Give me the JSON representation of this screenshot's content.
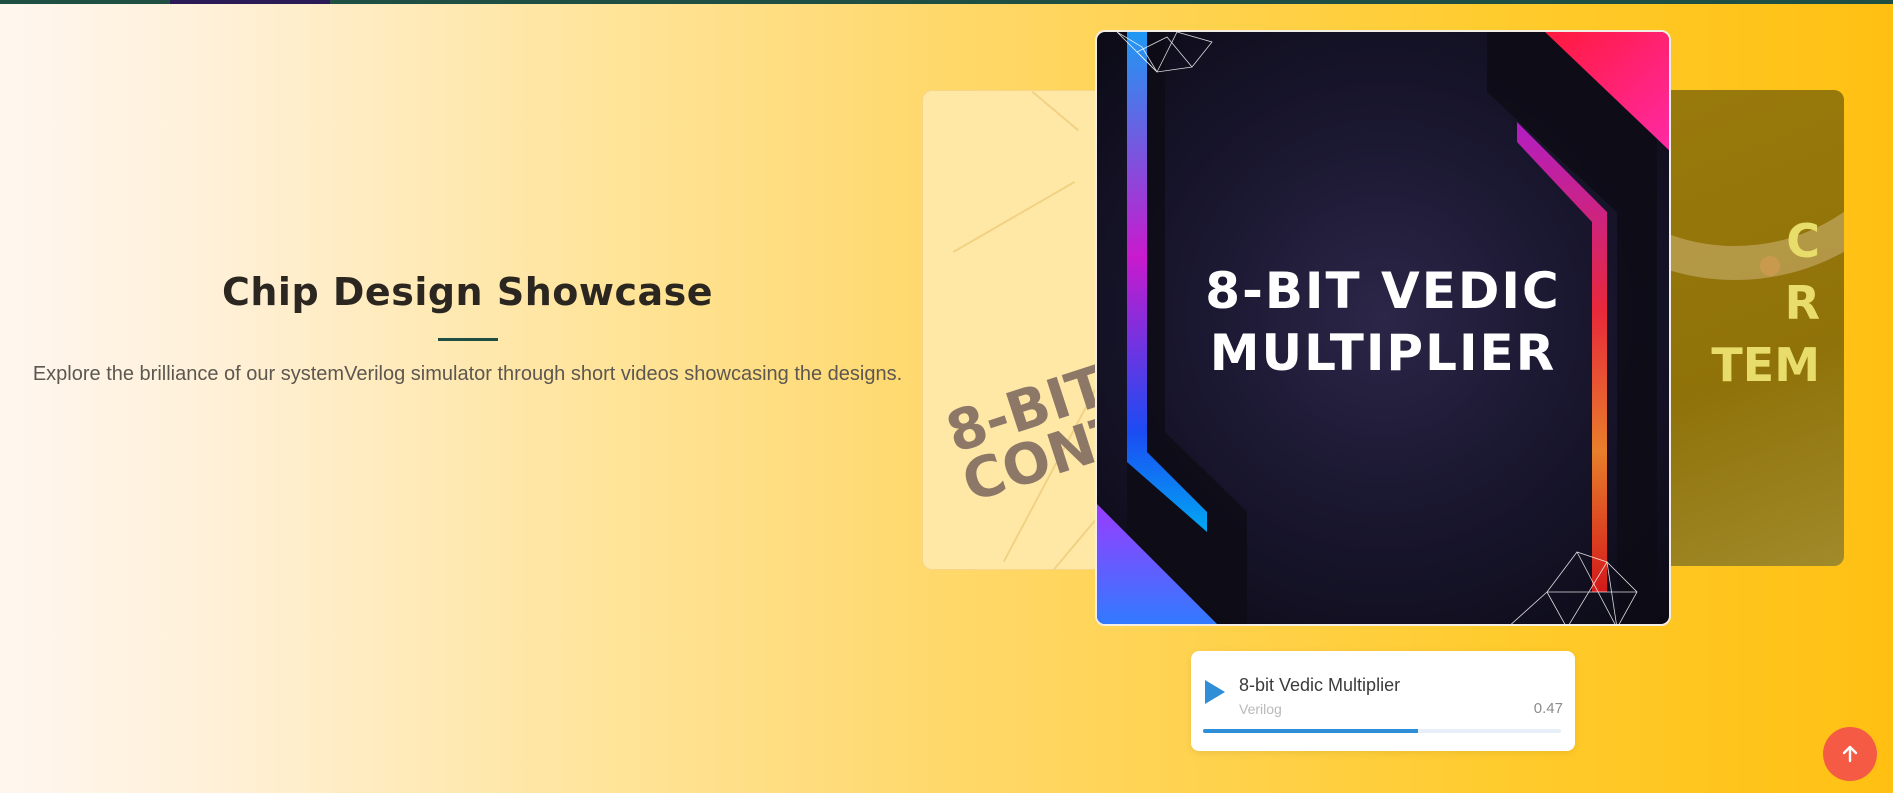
{
  "section": {
    "title": "Chip Design Showcase",
    "description": "Explore the brilliance of our systemVerilog simulator through short videos showcasing the designs."
  },
  "carousel": {
    "prev_card_text": "8-BIT\nCONT",
    "active_card_title": "8-BIT VEDIC MULTIPLIER",
    "next_card_text": "C\nR\nTEM"
  },
  "player": {
    "title": "8-bit Vedic Multiplier",
    "subtitle": "Verilog",
    "time": "0.47",
    "progress": 0.6,
    "play_icon": "play-icon",
    "accent_color": "#2e8ed8"
  },
  "scroll_top": {
    "icon": "arrow-up-icon",
    "color": "#f45a44"
  }
}
